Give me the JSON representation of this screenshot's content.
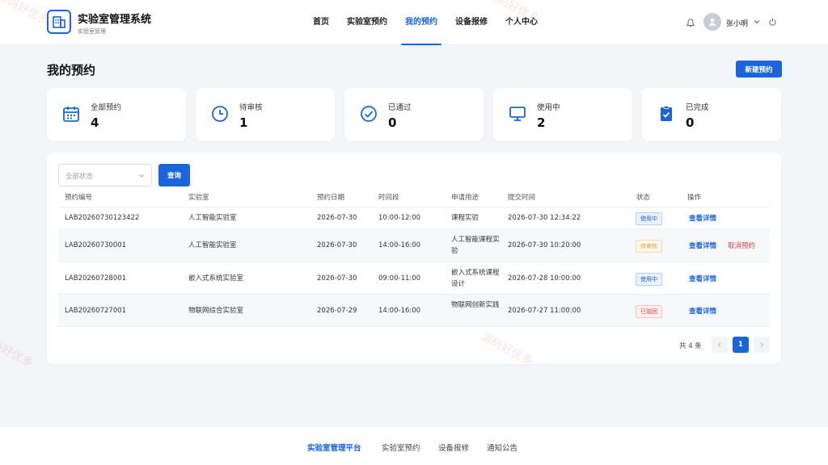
{
  "app": {
    "title": "实验室管理系统",
    "subtitle": "实验室管理"
  },
  "nav": [
    {
      "label": "首页"
    },
    {
      "label": "实验室预约"
    },
    {
      "label": "我的预约",
      "active": true
    },
    {
      "label": "设备报修"
    },
    {
      "label": "个人中心"
    }
  ],
  "user": {
    "name": "张小明"
  },
  "page": {
    "title": "我的预约",
    "new_button": "新建预约"
  },
  "stats": [
    {
      "label": "全部预约",
      "value": "4",
      "icon": "calendar-icon"
    },
    {
      "label": "待审核",
      "value": "1",
      "icon": "clock-icon"
    },
    {
      "label": "已通过",
      "value": "0",
      "icon": "check-circle-icon"
    },
    {
      "label": "使用中",
      "value": "2",
      "icon": "monitor-icon"
    },
    {
      "label": "已完成",
      "value": "0",
      "icon": "clipboard-check-icon"
    }
  ],
  "filter": {
    "status_placeholder": "全部状态",
    "query_button": "查询"
  },
  "table": {
    "headers": [
      "预约编号",
      "实验室",
      "预约日期",
      "时间段",
      "申请用途",
      "提交时间",
      "状态",
      "操作"
    ],
    "rows": [
      {
        "id": "LAB20260730123422",
        "lab": "人工智能实验室",
        "date": "2026-07-30",
        "time": "10:00-12:00",
        "purpose": "课程实验",
        "submitted": "2026-07-30 12:34:22",
        "status": "使用中",
        "view": "查看详情",
        "cancel": ""
      },
      {
        "id": "LAB20260730001",
        "lab": "人工智能实验室",
        "date": "2026-07-30",
        "time": "14:00-16:00",
        "purpose": "人工智能课程实验",
        "submitted": "2026-07-30 10:20:00",
        "status": "待审核",
        "view": "查看详情",
        "cancel": "取消预约"
      },
      {
        "id": "LAB20260728001",
        "lab": "嵌入式系统实验室",
        "date": "2026-07-30",
        "time": "09:00-11:00",
        "purpose": "嵌入式系统课程设计",
        "submitted": "2026-07-28 10:00:00",
        "status": "使用中",
        "view": "查看详情",
        "cancel": ""
      },
      {
        "id": "LAB20260727001",
        "lab": "物联网综合实验室",
        "date": "2026-07-29",
        "time": "14:00-16:00",
        "purpose": "物联网创新实践",
        "submitted": "2026-07-27 11:00:00",
        "status": "已驳回",
        "view": "查看详情",
        "cancel": ""
      }
    ]
  },
  "pagination": {
    "total": "共 4 条",
    "current": "1"
  },
  "footer": {
    "brand": "实验室管理平台",
    "links": [
      "实验室预约",
      "设备报修",
      "通知公告"
    ]
  },
  "watermark": "源码好优多",
  "colors": {
    "primary": "#1a64dc",
    "danger": "#e03a3a",
    "status_using": "#1a64dc",
    "status_pending": "#e6a23c",
    "status_rejected": "#e03a3a"
  }
}
